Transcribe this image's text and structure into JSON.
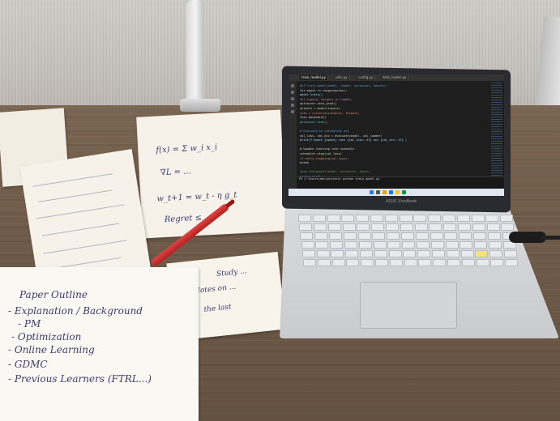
{
  "scene": {
    "description_tags": [
      "desk",
      "laptop",
      "handwritten-notes",
      "red-pen",
      "lamp"
    ],
    "laptop": {
      "brand_label": "ASUS VivoBook",
      "editor_tabs": [
        "train_model.py",
        "utils.py",
        "config.py",
        "data_loader.py"
      ],
      "active_tab_index": 0,
      "code_lines": [
        "def train_model(model, loader, optimizer, epochs):",
        "    for epoch in range(epochs):",
        "        model.train()",
        "        for inputs, targets in loader:",
        "            optimizer.zero_grad()",
        "            outputs = model(inputs)",
        "            loss = criterion(outputs, targets)",
        "            loss.backward()",
        "            optimizer.step()",
        "",
        "    # Evaluate on validation set",
        "    val_loss, val_acc = evaluate(model, val_loader)",
        "    print(f'epoch {epoch} loss {val_loss:.4f} acc {val_acc:.3f}')",
        "",
        "    # Update learning rate schedule",
        "    scheduler.step(val_loss)",
        "    if early_stopping(val_loss):",
        "        break",
        "",
        "    save_checkpoint(model, optimizer, epoch)",
        "return model"
      ],
      "terminal_line": "PS C:\\Users\\dev\\project> python train_model.py"
    },
    "notes": {
      "bottom_sheet_lines": [
        "Paper Outline",
        "- Explanation / Background",
        "  - PM",
        "  - Optimization",
        "  - Online Learning",
        "- GDMC",
        "- Previous Learners (FTRL...)"
      ],
      "top_sheet_lines": [
        "f(x) = Σ w_i x_i",
        "∇L = ...",
        "w_t+1 = w_t - η g_t",
        "Regret ≤ ..."
      ],
      "small_sheet_lines": [
        "Study ...",
        "Notes on ...",
        "the last"
      ]
    }
  }
}
